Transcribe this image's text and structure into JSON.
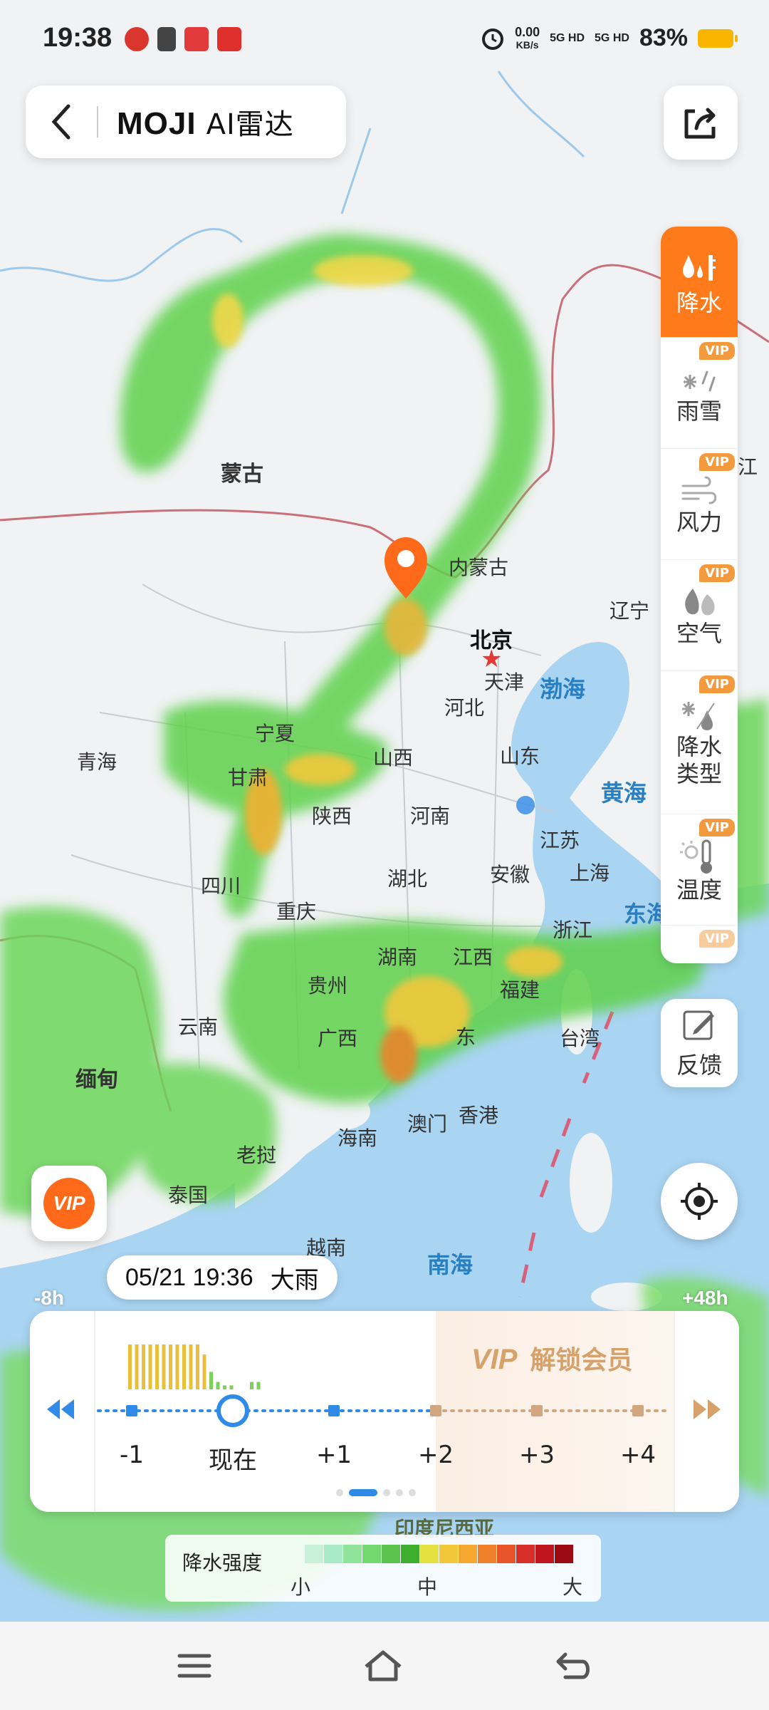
{
  "status_bar": {
    "time": "19:38",
    "net_speed_value": "0.00",
    "net_speed_unit": "KB/s",
    "signal1": "5G HD",
    "signal2": "5G HD",
    "battery": "83%"
  },
  "header": {
    "brand": "MOJI",
    "title": "AI雷达",
    "back_icon": "chevron-left-icon",
    "share_icon": "share-icon"
  },
  "map_labels": {
    "mongolia": "蒙古",
    "inner_mongolia": "内蒙古",
    "beijing": "北京",
    "tianjin": "天津",
    "liaoning": "辽宁",
    "bohai": "渤海",
    "hebei": "河北",
    "ningxia": "宁夏",
    "qinghai": "青海",
    "gansu": "甘肃",
    "shanxi": "山西",
    "shandong": "山东",
    "huanghai": "黄海",
    "shaanxi": "陕西",
    "henan": "河南",
    "jiangsu": "江苏",
    "sichuan": "四川",
    "hubei": "湖北",
    "anhui": "安徽",
    "shanghai": "上海",
    "chongqing": "重庆",
    "zhejiang": "浙江",
    "donghai": "东海",
    "hunan": "湖南",
    "jiangxi": "江西",
    "guizhou": "贵州",
    "fujian": "福建",
    "yunnan": "云南",
    "guangxi": "广西",
    "guangdong": "东",
    "taiwan": "台湾",
    "myanmar": "缅甸",
    "hainan": "海南",
    "macau": "澳门",
    "hongkong": "香港",
    "laos": "老挝",
    "thailand": "泰国",
    "vietnam": "越南",
    "nanhai": "南海",
    "indonesia": "印度尼西亚",
    "edge_right": "江"
  },
  "layers": [
    {
      "label": "降水",
      "vip": false,
      "active": true,
      "icon": "precipitation-icon"
    },
    {
      "label": "雨雪",
      "vip": true,
      "active": false,
      "icon": "rain-snow-icon"
    },
    {
      "label": "风力",
      "vip": true,
      "active": false,
      "icon": "wind-icon"
    },
    {
      "label": "空气",
      "vip": true,
      "active": false,
      "icon": "air-quality-icon"
    },
    {
      "label": "降水类型",
      "label_line1": "降水",
      "label_line2": "类型",
      "vip": true,
      "active": false,
      "icon": "precip-type-icon"
    },
    {
      "label": "温度",
      "vip": true,
      "active": false,
      "icon": "thermometer-icon"
    }
  ],
  "vip_tag": "VIP",
  "feedback": {
    "label": "反馈",
    "icon": "edit-icon"
  },
  "vip_button": "VIP",
  "tooltip": {
    "datetime": "05/21 19:36",
    "condition": "大雨"
  },
  "time_range": {
    "start": "-8h",
    "end": "+48h"
  },
  "timeline": {
    "vip_prefix": "VIP",
    "vip_text": "解锁会员",
    "ticks": [
      "-1",
      "现在",
      "+1",
      "+2",
      "+3",
      "+4"
    ],
    "rain_bars": [
      0.9,
      0.9,
      0.9,
      0.9,
      0.9,
      0.9,
      0.9,
      0.9,
      0.9,
      0.9,
      0.9,
      0.7,
      0.35,
      0.15,
      0.08,
      0.08,
      0,
      0,
      0.15,
      0.15
    ]
  },
  "legend": {
    "title": "降水强度",
    "low": "小",
    "mid": "中",
    "high": "大",
    "colors": [
      "#c8f0d8",
      "#a9ebc8",
      "#8fe49a",
      "#74d870",
      "#5cc44e",
      "#3eae2e",
      "#e4e040",
      "#f0c83a",
      "#f5a830",
      "#f0802a",
      "#e8552a",
      "#d82e2a",
      "#c0141e",
      "#9c0a14"
    ]
  },
  "nav": {
    "menu_icon": "menu-icon",
    "home_icon": "home-icon",
    "back_icon": "back-icon"
  }
}
